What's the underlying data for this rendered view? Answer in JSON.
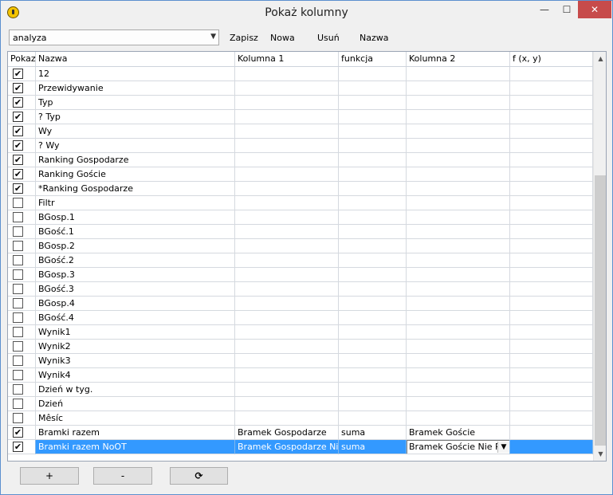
{
  "window": {
    "title": "Pokaż kolumny",
    "min_label": "—",
    "max_label": "☐",
    "close_label": "✕"
  },
  "toolbar": {
    "combo_value": "analyza",
    "save": "Zapisz",
    "new": "Nowa",
    "delete": "Usuń",
    "name": "Nazwa"
  },
  "columns": [
    "Pokaz",
    "Nazwa",
    "Kolumna 1",
    "funkcja",
    "Kolumna 2",
    "f (x, y)"
  ],
  "rows": [
    {
      "checked": true,
      "name": "12",
      "k1": "",
      "fn": "",
      "k2": "",
      "f": ""
    },
    {
      "checked": true,
      "name": "Przewidywanie",
      "k1": "",
      "fn": "",
      "k2": "",
      "f": ""
    },
    {
      "checked": true,
      "name": "Typ",
      "k1": "",
      "fn": "",
      "k2": "",
      "f": ""
    },
    {
      "checked": true,
      "name": "? Typ",
      "k1": "",
      "fn": "",
      "k2": "",
      "f": ""
    },
    {
      "checked": true,
      "name": "Wy",
      "k1": "",
      "fn": "",
      "k2": "",
      "f": ""
    },
    {
      "checked": true,
      "name": "? Wy",
      "k1": "",
      "fn": "",
      "k2": "",
      "f": ""
    },
    {
      "checked": true,
      "name": "Ranking Gospodarze",
      "k1": "",
      "fn": "",
      "k2": "",
      "f": ""
    },
    {
      "checked": true,
      "name": "Ranking Goście",
      "k1": "",
      "fn": "",
      "k2": "",
      "f": ""
    },
    {
      "checked": true,
      "name": "*Ranking Gospodarze",
      "k1": "",
      "fn": "",
      "k2": "",
      "f": ""
    },
    {
      "checked": false,
      "name": "Filtr",
      "k1": "",
      "fn": "",
      "k2": "",
      "f": ""
    },
    {
      "checked": false,
      "name": "BGosp.1",
      "k1": "",
      "fn": "",
      "k2": "",
      "f": ""
    },
    {
      "checked": false,
      "name": "BGość.1",
      "k1": "",
      "fn": "",
      "k2": "",
      "f": ""
    },
    {
      "checked": false,
      "name": "BGosp.2",
      "k1": "",
      "fn": "",
      "k2": "",
      "f": ""
    },
    {
      "checked": false,
      "name": "BGość.2",
      "k1": "",
      "fn": "",
      "k2": "",
      "f": ""
    },
    {
      "checked": false,
      "name": "BGosp.3",
      "k1": "",
      "fn": "",
      "k2": "",
      "f": ""
    },
    {
      "checked": false,
      "name": "BGość.3",
      "k1": "",
      "fn": "",
      "k2": "",
      "f": ""
    },
    {
      "checked": false,
      "name": "BGosp.4",
      "k1": "",
      "fn": "",
      "k2": "",
      "f": ""
    },
    {
      "checked": false,
      "name": "BGość.4",
      "k1": "",
      "fn": "",
      "k2": "",
      "f": ""
    },
    {
      "checked": false,
      "name": "Wynik1",
      "k1": "",
      "fn": "",
      "k2": "",
      "f": ""
    },
    {
      "checked": false,
      "name": "Wynik2",
      "k1": "",
      "fn": "",
      "k2": "",
      "f": ""
    },
    {
      "checked": false,
      "name": "Wynik3",
      "k1": "",
      "fn": "",
      "k2": "",
      "f": ""
    },
    {
      "checked": false,
      "name": "Wynik4",
      "k1": "",
      "fn": "",
      "k2": "",
      "f": ""
    },
    {
      "checked": false,
      "name": "Dzień w tyg.",
      "k1": "",
      "fn": "",
      "k2": "",
      "f": ""
    },
    {
      "checked": false,
      "name": "Dzień",
      "k1": "",
      "fn": "",
      "k2": "",
      "f": ""
    },
    {
      "checked": false,
      "name": "Mêsíc",
      "k1": "",
      "fn": "",
      "k2": "",
      "f": ""
    },
    {
      "checked": true,
      "name": "Bramki razem",
      "k1": "Bramek Gospodarze",
      "fn": "suma",
      "k2": "Bramek Goście",
      "f": ""
    },
    {
      "checked": true,
      "name": "Bramki razem NoOT",
      "k1": "Bramek Gospodarze Nie P",
      "fn": "suma",
      "k2": "Bramek Goście Nie P",
      "f": "",
      "selected": true
    }
  ],
  "icons": {
    "check": "✔",
    "combo_arrow": "▼",
    "scroll_up": "▲",
    "scroll_down": "▼",
    "refresh": "⟳"
  },
  "bottom": {
    "add": "+",
    "remove": "-"
  }
}
